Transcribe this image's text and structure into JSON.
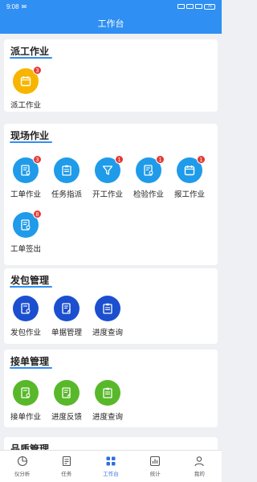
{
  "status": {
    "time": "9:08",
    "battery": "76"
  },
  "header": {
    "title": "工作台"
  },
  "sections": {
    "dispatch": {
      "title": "派工作业",
      "items": [
        {
          "label": "派工作业",
          "badge": "3"
        }
      ]
    },
    "onsite": {
      "title": "现场作业",
      "items": [
        {
          "label": "工单作业",
          "badge": "3"
        },
        {
          "label": "任务指派",
          "badge": ""
        },
        {
          "label": "开工作业",
          "badge": "1"
        },
        {
          "label": "检验作业",
          "badge": "1"
        },
        {
          "label": "报工作业",
          "badge": "1"
        },
        {
          "label": "工单签出",
          "badge": "8"
        }
      ]
    },
    "subcontract": {
      "title": "发包管理",
      "items": [
        {
          "label": "发包作业"
        },
        {
          "label": "单据管理"
        },
        {
          "label": "进度查询"
        }
      ]
    },
    "receive": {
      "title": "接单管理",
      "items": [
        {
          "label": "接单作业"
        },
        {
          "label": "进度反馈"
        },
        {
          "label": "进度查询"
        }
      ]
    },
    "quality": {
      "title": "品质管理"
    }
  },
  "tabbar": {
    "items": [
      {
        "label": "仪分析"
      },
      {
        "label": "任务"
      },
      {
        "label": "工作台"
      },
      {
        "label": "统计"
      },
      {
        "label": "我的"
      }
    ]
  },
  "colors": {
    "primary": "#2f8ff2",
    "yellow": "#f7b500",
    "blue": "#1f9be9",
    "navy": "#1b4fcf",
    "green": "#58b82a",
    "badge": "#e53935"
  }
}
